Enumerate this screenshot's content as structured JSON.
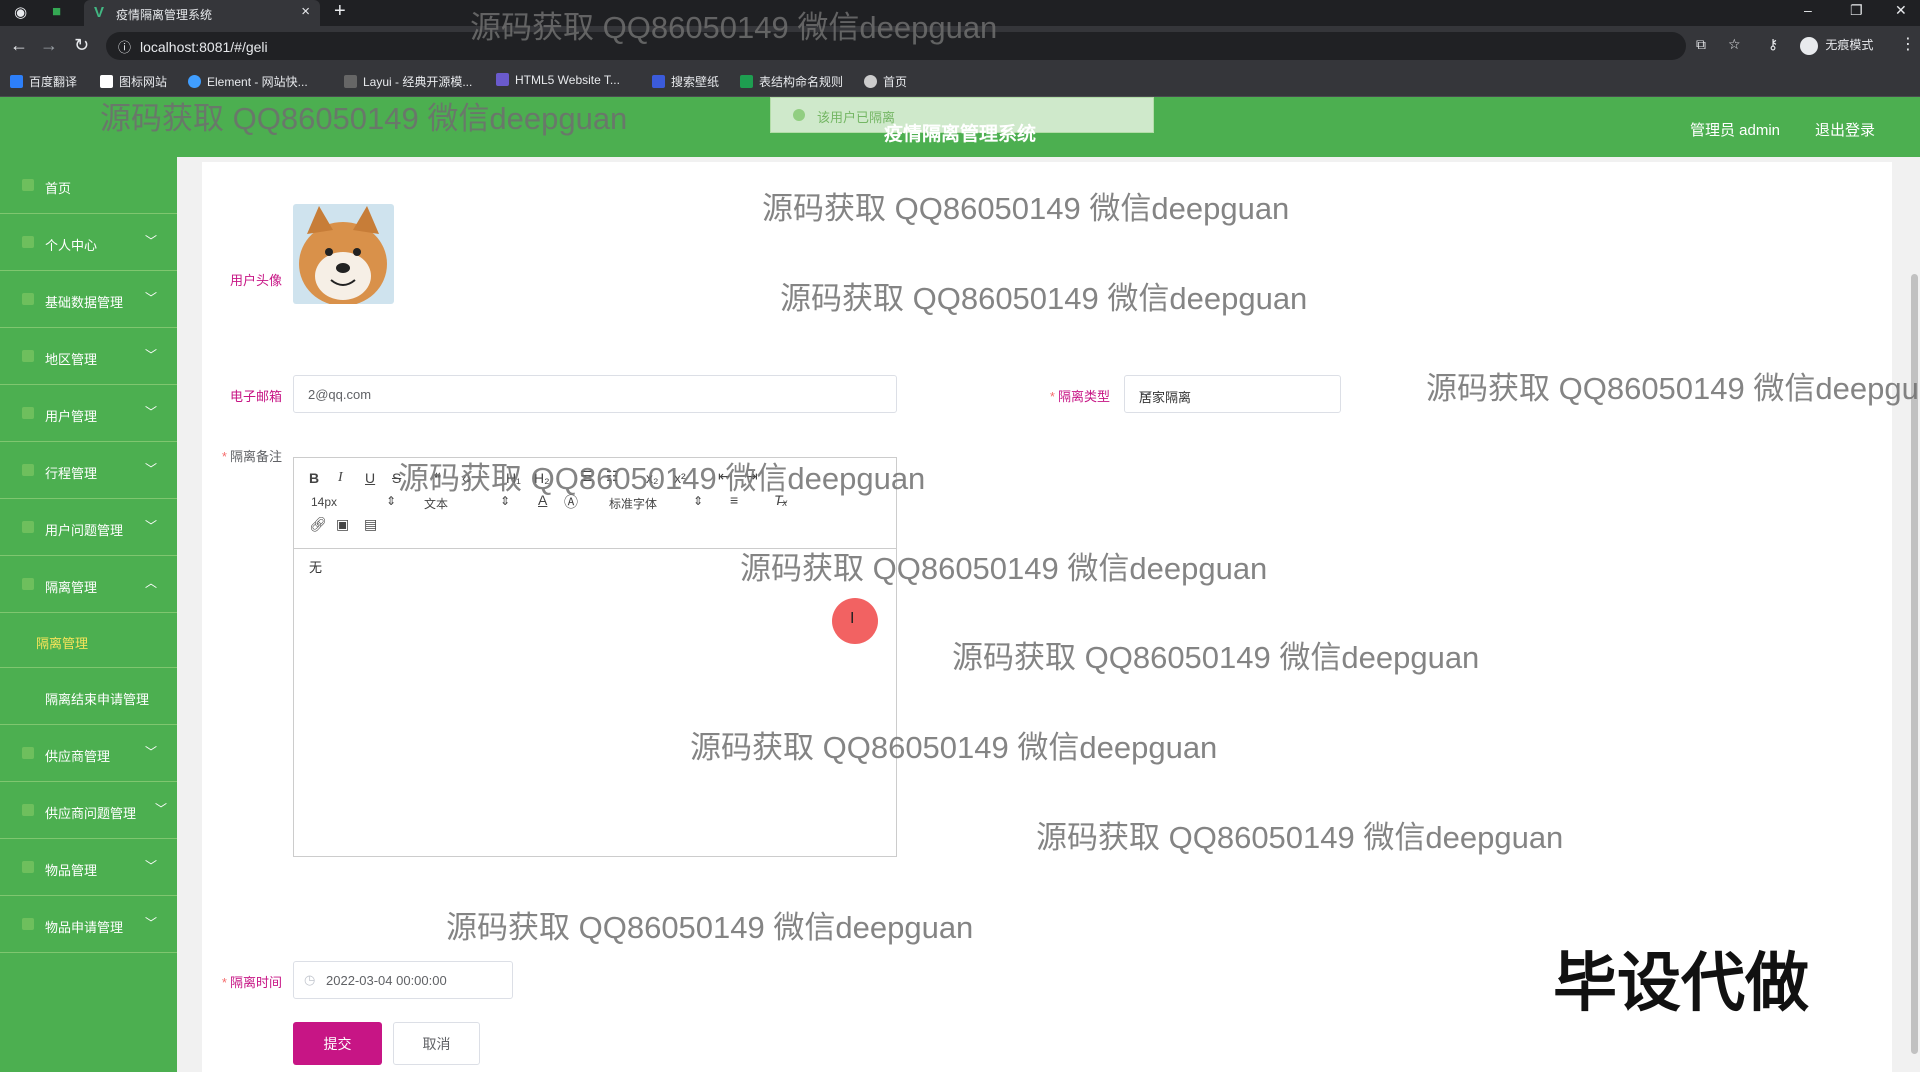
{
  "browser": {
    "tab_title": "疫情隔离管理系统",
    "url": "localhost:8081/#/geli",
    "incognito_label": "无痕模式",
    "bookmarks": [
      "百度翻译",
      "图标网站",
      "Element - 网站快...",
      "Layui - 经典开源模...",
      "HTML5 Website T...",
      "搜索壁纸",
      "表结构命名规则",
      "首页"
    ]
  },
  "header": {
    "title": "疫情隔离管理系统",
    "toast": "该用户已隔离",
    "user": "管理员 admin",
    "logout": "退出登录"
  },
  "sidebar": {
    "items": [
      {
        "label": "首页",
        "arrow": ""
      },
      {
        "label": "个人中心",
        "arrow": "﹀"
      },
      {
        "label": "基础数据管理",
        "arrow": "﹀"
      },
      {
        "label": "地区管理",
        "arrow": "﹀"
      },
      {
        "label": "用户管理",
        "arrow": "﹀"
      },
      {
        "label": "行程管理",
        "arrow": "﹀"
      },
      {
        "label": "用户问题管理",
        "arrow": "﹀"
      },
      {
        "label": "隔离管理",
        "arrow": "︿"
      }
    ],
    "sub_active": "隔离管理",
    "sub_other": "隔离结束申请管理",
    "items2": [
      {
        "label": "供应商管理",
        "arrow": "﹀"
      },
      {
        "label": "供应商问题管理",
        "arrow": "﹀"
      },
      {
        "label": "物品管理",
        "arrow": "﹀"
      },
      {
        "label": "物品申请管理",
        "arrow": "﹀"
      }
    ]
  },
  "form": {
    "avatar_label": "用户头像",
    "email_label": "电子邮箱",
    "email_value": "2@qq.com",
    "type_label": "隔离类型",
    "type_value": "居家隔离",
    "remark_label": "隔离备注",
    "editor": {
      "font_size": "14px",
      "block_type": "文本",
      "font_family": "标准字体",
      "content": "无"
    },
    "time_label": "隔离时间",
    "time_value": "2022-03-04 00:00:00",
    "submit": "提交",
    "cancel": "取消"
  },
  "watermark": "源码获取 QQ86050149 微信deepguan",
  "stamp": "毕设代做"
}
